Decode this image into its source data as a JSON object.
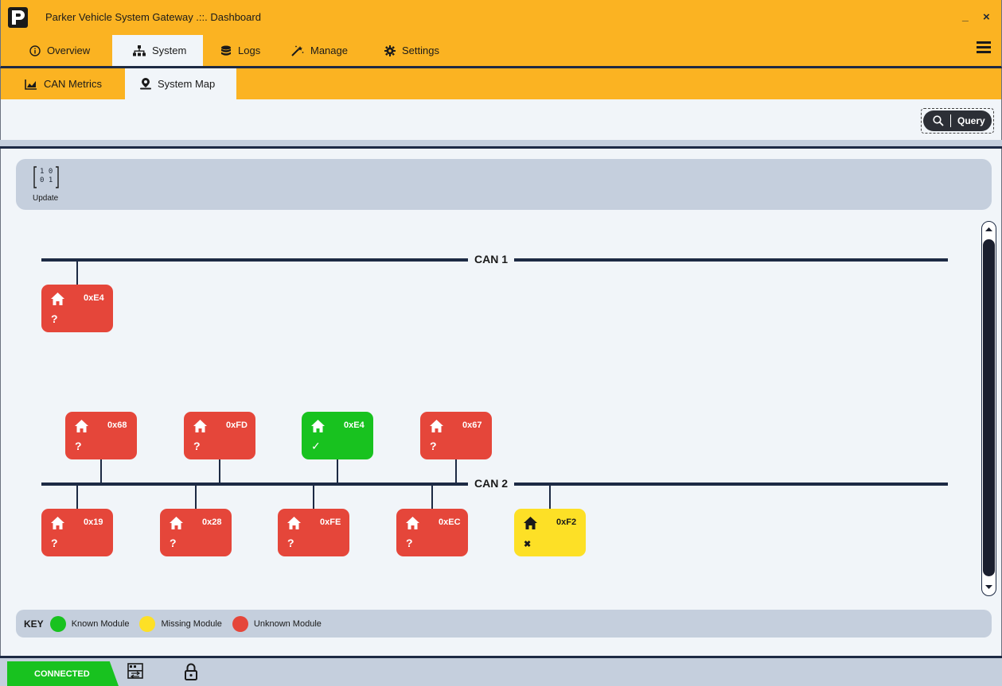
{
  "window": {
    "title": "Parker Vehicle System Gateway .::. Dashboard",
    "min_glyph": "_",
    "close_glyph": "×"
  },
  "main_tabs": [
    {
      "label": "Overview",
      "icon": "info-circle-icon"
    },
    {
      "label": "System",
      "icon": "sitemap-icon",
      "active": true
    },
    {
      "label": "Logs",
      "icon": "database-icon"
    },
    {
      "label": "Manage",
      "icon": "magic-wand-icon"
    },
    {
      "label": "Settings",
      "icon": "gear-icon"
    }
  ],
  "sub_tabs": [
    {
      "label": "CAN Metrics",
      "icon": "area-chart-icon"
    },
    {
      "label": "System Map",
      "icon": "map-pin-user-icon",
      "active": true
    }
  ],
  "toolbar": {
    "query_label": "Query"
  },
  "update": {
    "label": "Update",
    "matrix_top": "1 0",
    "matrix_bottom": "0 1"
  },
  "buses": [
    {
      "name": "CAN 1"
    },
    {
      "name": "CAN 2"
    }
  ],
  "modules": {
    "can1": [
      {
        "addr": "0xE4",
        "state": "unknown",
        "mark": "?"
      }
    ],
    "can2_top": [
      {
        "addr": "0x68",
        "state": "unknown",
        "mark": "?"
      },
      {
        "addr": "0xFD",
        "state": "unknown",
        "mark": "?"
      },
      {
        "addr": "0xE4",
        "state": "known",
        "mark": "✓"
      },
      {
        "addr": "0x67",
        "state": "unknown",
        "mark": "?"
      }
    ],
    "can2_bottom": [
      {
        "addr": "0x19",
        "state": "unknown",
        "mark": "?"
      },
      {
        "addr": "0x28",
        "state": "unknown",
        "mark": "?"
      },
      {
        "addr": "0xFE",
        "state": "unknown",
        "mark": "?"
      },
      {
        "addr": "0xEC",
        "state": "unknown",
        "mark": "?"
      },
      {
        "addr": "0xF2",
        "state": "missing",
        "mark": "✖"
      }
    ]
  },
  "key": {
    "title": "KEY",
    "items": [
      {
        "label": "Known Module",
        "color": "#18c21f"
      },
      {
        "label": "Missing Module",
        "color": "#fde026"
      },
      {
        "label": "Unknown Module",
        "color": "#e5463a"
      }
    ]
  },
  "colors": {
    "accent": "#fbb322",
    "navy": "#1d2a44",
    "known": "#18c21f",
    "missing": "#fde026",
    "unknown": "#e5463a"
  },
  "status_bar": {
    "connection": "CONNECTED"
  }
}
